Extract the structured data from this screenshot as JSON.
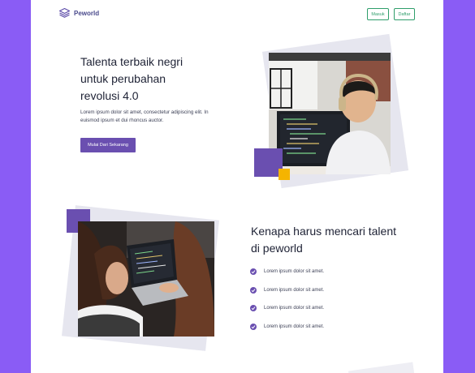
{
  "header": {
    "brand": "Peworld",
    "login_label": "Masuk",
    "register_label": "Daftar"
  },
  "hero": {
    "title_line1": "Talenta terbaik negri",
    "title_line2": "untuk perubahan",
    "title_line3": "revolusi 4.0",
    "description": "Lorem ipsum dolor sit amet, consectetur adipiscing elit. In euismod ipsum et dui rhoncus auctor.",
    "cta_label": "Mulai Dari Sekarang"
  },
  "why": {
    "title_line1": "Kenapa harus mencari talent",
    "title_line2": "di peworld",
    "items": [
      "Lorem ipsum dolor sit amet.",
      "Lorem ipsum dolor sit amet.",
      "Lorem ipsum dolor sit amet.",
      "Lorem ipsum dolor sit amet."
    ]
  },
  "colors": {
    "background": "#8a5cf5",
    "primary": "#6a4fb0",
    "accent_yellow": "#f5b400",
    "outline_green": "#2f9e6b"
  }
}
